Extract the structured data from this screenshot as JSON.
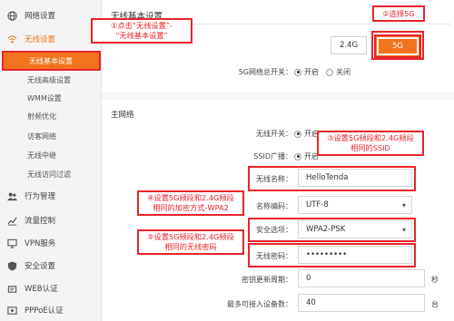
{
  "sidebar": {
    "items": [
      {
        "label": "网络设置",
        "icon": "globe-icon"
      },
      {
        "label": "无线设置",
        "icon": "wifi-icon"
      },
      {
        "label": "行为管理",
        "icon": "users-icon"
      },
      {
        "label": "流量控制",
        "icon": "chart-icon"
      },
      {
        "label": "VPN服务",
        "icon": "monitor-icon"
      },
      {
        "label": "安全设置",
        "icon": "shield-icon"
      },
      {
        "label": "WEB认证",
        "icon": "key-icon"
      },
      {
        "label": "PPPoE认证",
        "icon": "dialup-icon"
      }
    ],
    "subitems": [
      "无线基本设置",
      "无线高级设置",
      "WMM设置",
      "射频优化",
      "访客网络",
      "无线中继",
      "无线访问过滤"
    ]
  },
  "main": {
    "title": "无线基本设置",
    "band_24": "2.4G",
    "band_5": "5G",
    "network_switch_label": "5G网络总开关：",
    "on": "开启",
    "off": "关闭",
    "section_title": "主网络",
    "wireless_switch_label": "无线开关：",
    "ssid_broadcast_label": "SSID广播：",
    "ssid_label": "无线名称：",
    "ssid_value": "HelloTenda",
    "encoding_label": "名称编码：",
    "encoding_value": "UTF-8",
    "security_label": "安全选项：",
    "security_value": "WPA2-PSK",
    "password_label": "无线密码：",
    "password_value": "•••••••••",
    "key_period_label": "密钥更新周期：",
    "key_period_value": "0",
    "key_period_unit": "秒",
    "max_devices_label": "最多可接入设备数：",
    "max_devices_value": "40",
    "max_devices_unit": "台"
  },
  "annotations": {
    "step1_line1": "①点击“无线设置”-",
    "step1_line2": "“无线基本设置”",
    "step2": "②选择5G",
    "step3_line1": "③设置5G频段和2.4G频段",
    "step3_line2": "相同的SSID",
    "step4_line1": "④设置5G频段和2.4G频段",
    "step4_line2": "相同的加密方式-WPA2",
    "step5_line1": "⑤设置5G频段和2.4G频段",
    "step5_line2": "相同的无线密码"
  },
  "colors": {
    "accent": "#f0731d",
    "annotation_red": "#e8242a"
  }
}
